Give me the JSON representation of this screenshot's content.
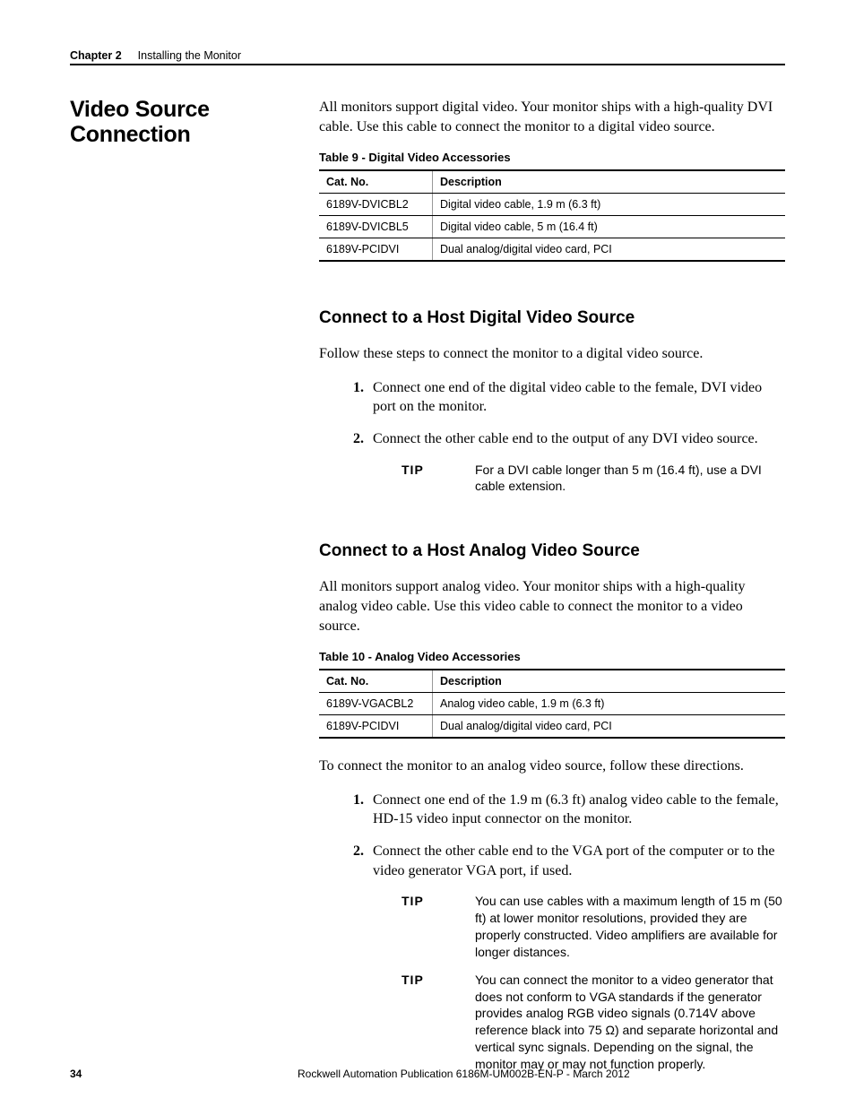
{
  "header": {
    "chapter_label": "Chapter 2",
    "chapter_title": "Installing the Monitor"
  },
  "section": {
    "title": "Video Source Connection",
    "intro": "All monitors support digital video. Your monitor ships with a high-quality DVI cable. Use this cable to connect the monitor to a digital video source."
  },
  "table9": {
    "caption": "Table 9 - Digital Video Accessories",
    "headers": {
      "cat": "Cat. No.",
      "desc": "Description"
    },
    "rows": [
      {
        "cat": "6189V-DVICBL2",
        "desc": "Digital video cable, 1.9 m (6.3 ft)"
      },
      {
        "cat": "6189V-DVICBL5",
        "desc": "Digital video cable, 5 m (16.4 ft)"
      },
      {
        "cat": "6189V-PCIDVI",
        "desc": "Dual analog/digital video card, PCI"
      }
    ]
  },
  "digital": {
    "heading": "Connect to a Host Digital Video Source",
    "lead": "Follow these steps to connect the monitor to a digital video source.",
    "steps": [
      "Connect one end of the digital video cable to the female, DVI video port on the monitor.",
      "Connect the other cable end to the output of any DVI video source."
    ],
    "tip_label": "TIP",
    "tip": "For a DVI cable longer than 5 m (16.4 ft), use a DVI cable extension."
  },
  "analog": {
    "heading": "Connect to a Host Analog Video Source",
    "lead": "All monitors support analog video. Your monitor ships with a high-quality analog video cable. Use this video cable to connect the monitor to a video source."
  },
  "table10": {
    "caption": "Table 10 - Analog Video Accessories",
    "headers": {
      "cat": "Cat. No.",
      "desc": "Description"
    },
    "rows": [
      {
        "cat": "6189V-VGACBL2",
        "desc": "Analog video cable, 1.9 m (6.3 ft)"
      },
      {
        "cat": "6189V-PCIDVI",
        "desc": "Dual analog/digital video card, PCI"
      }
    ]
  },
  "analog_proc": {
    "lead": "To connect the monitor to an analog video source, follow these directions.",
    "steps": [
      "Connect one end of the 1.9 m (6.3 ft) analog video cable to the female, HD-15 video input connector on the monitor.",
      "Connect the other cable end to the VGA port of the computer or to the video generator VGA port, if used."
    ],
    "tip_label": "TIP",
    "tips": [
      "You can use cables with a maximum length of 15 m (50 ft) at lower monitor resolutions, provided they are properly constructed. Video amplifiers are available for longer distances.",
      "You can connect the monitor to a video generator that does not conform to VGA standards if the generator provides analog RGB video signals (0.714V above reference black into 75 Ω) and separate horizontal and vertical sync signals. Depending on the signal, the monitor may or may not function properly."
    ]
  },
  "footer": {
    "page": "34",
    "pub": "Rockwell Automation Publication 6186M-UM002B-EN-P - March 2012"
  }
}
